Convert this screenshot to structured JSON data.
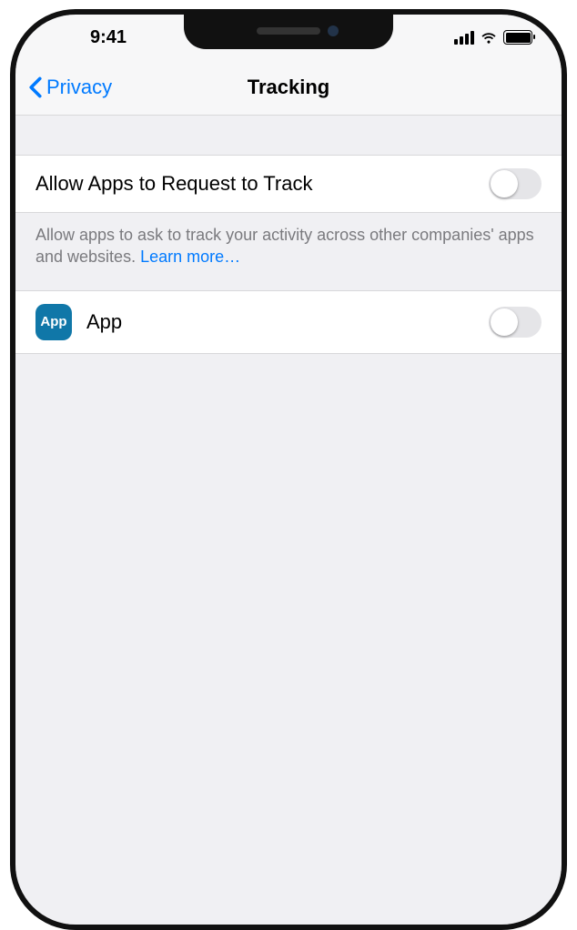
{
  "status": {
    "time": "9:41"
  },
  "nav": {
    "back": "Privacy",
    "title": "Tracking"
  },
  "settings": {
    "allow_label": "Allow Apps to Request to Track",
    "allow_value": false,
    "footer_text": "Allow apps to ask to track your activity across other companies' apps and websites. ",
    "learn_more": "Learn more…"
  },
  "apps": [
    {
      "icon_label": "App",
      "name": "App",
      "value": false
    }
  ]
}
